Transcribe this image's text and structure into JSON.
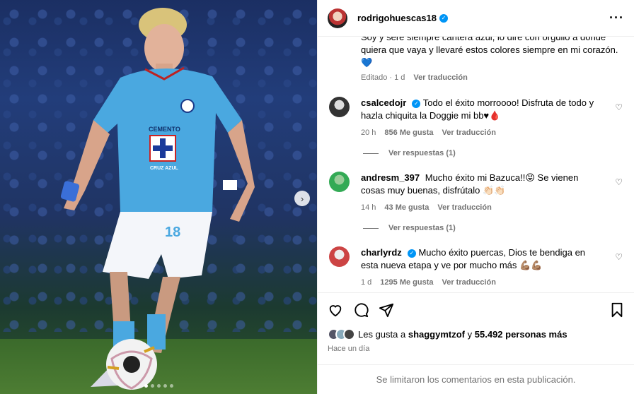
{
  "post": {
    "username": "rodrigohuescas18",
    "caption_text": "Soy y seré siempre cantera azul, lo diré con orgullo a donde quiera que vaya y llevaré estos colores siempre en mi corazón.",
    "caption_emoji": "💙",
    "caption_edited": "Editado",
    "caption_time": "1 d",
    "translate": "Ver traducción"
  },
  "comments": [
    {
      "username": "csalcedojr",
      "verified": true,
      "text": "Todo el éxito morroooo! Disfruta de todo y hazla chiquita la Doggie mi bb♥🩸",
      "time": "20 h",
      "likes": "856 Me gusta",
      "translate": "Ver traducción",
      "replies": "Ver respuestas (1)"
    },
    {
      "username": "andresm_397",
      "verified": false,
      "text": "Mucho éxito mi Bazuca!!😝 Se vienen cosas muy buenas, disfrútalo 👏🏻👏🏻",
      "time": "14 h",
      "likes": "43 Me gusta",
      "translate": "Ver traducción",
      "replies": "Ver respuestas (1)"
    },
    {
      "username": "charlyrdz",
      "verified": true,
      "text": "Mucho éxito puercas, Dios te bendiga en esta nueva etapa y ve por mucho más 💪🏽💪🏽",
      "time": "1 d",
      "likes": "1295 Me gusta",
      "translate": "Ver traducción"
    }
  ],
  "likes_summary": {
    "prefix": "Les gusta a",
    "user": "shaggymtzof",
    "join": "y",
    "others": "55.492 personas más"
  },
  "time_ago": "Hace un día",
  "footer_text": "Se limitaron los comentarios en esta publicación.",
  "jersey": {
    "sponsor": "CEMENTO",
    "team": "CRUZ AZUL",
    "number": "18"
  },
  "icons": [
    "heart-icon",
    "comment-icon",
    "share-icon",
    "bookmark-icon",
    "more-icon",
    "next-icon"
  ],
  "colors": {
    "verified": "#0095f6",
    "jersey": "#4aa8e0",
    "muted": "#737373"
  }
}
